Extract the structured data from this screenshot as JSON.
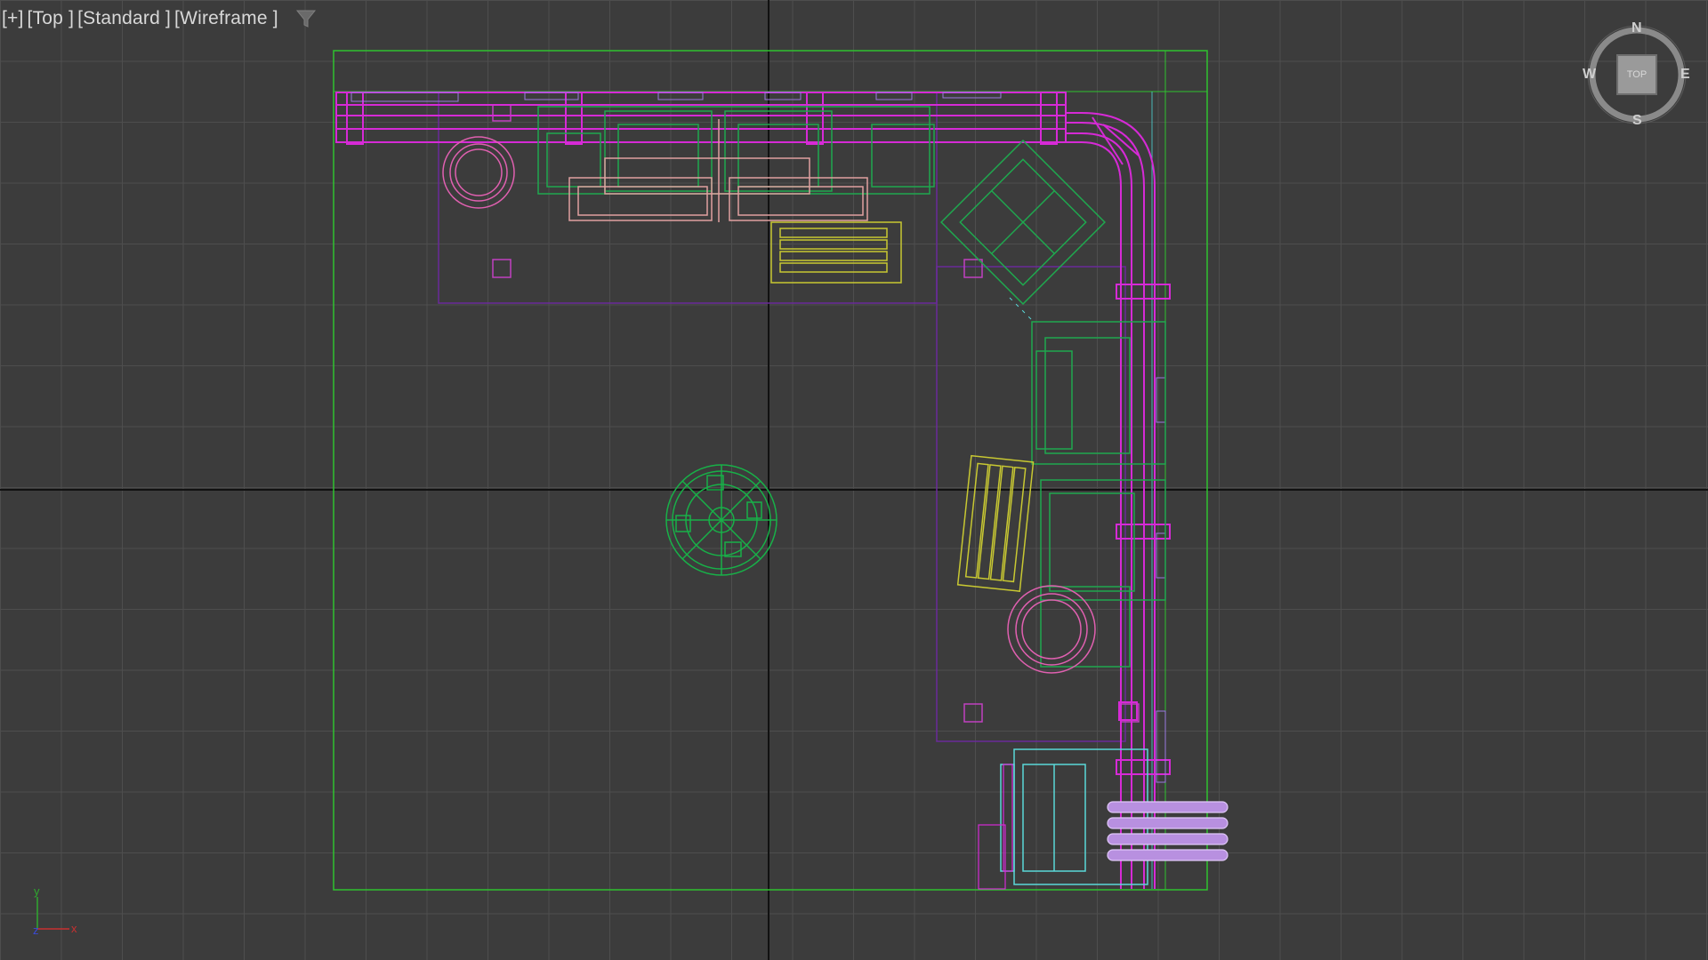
{
  "viewport": {
    "label_plus": "[+]",
    "label_view": "[Top ]",
    "label_shading": "[Standard ]",
    "label_mode": "[Wireframe ]"
  },
  "viewcube": {
    "face_label": "TOP",
    "north": "N",
    "south": "S",
    "east": "E",
    "west": "W"
  },
  "tripod": {
    "axis_y": "y",
    "axis_x": "x",
    "axis_z": "z"
  },
  "colors": {
    "background": "#3c3c3c",
    "grid": "#4e4e4e",
    "room_outline": "#2ec22e",
    "desk_magenta": "#d62ad6",
    "furniture_green": "#1fa84f",
    "keyboard_yellow": "#c8c832",
    "chair_pink": "#e0a0a0",
    "rug_purple": "#6a2a9a",
    "cyan": "#5ad8d8",
    "lavender": "#c49ae8",
    "waste_bin_pink": "#e060b0",
    "plant_green": "#18b048"
  }
}
